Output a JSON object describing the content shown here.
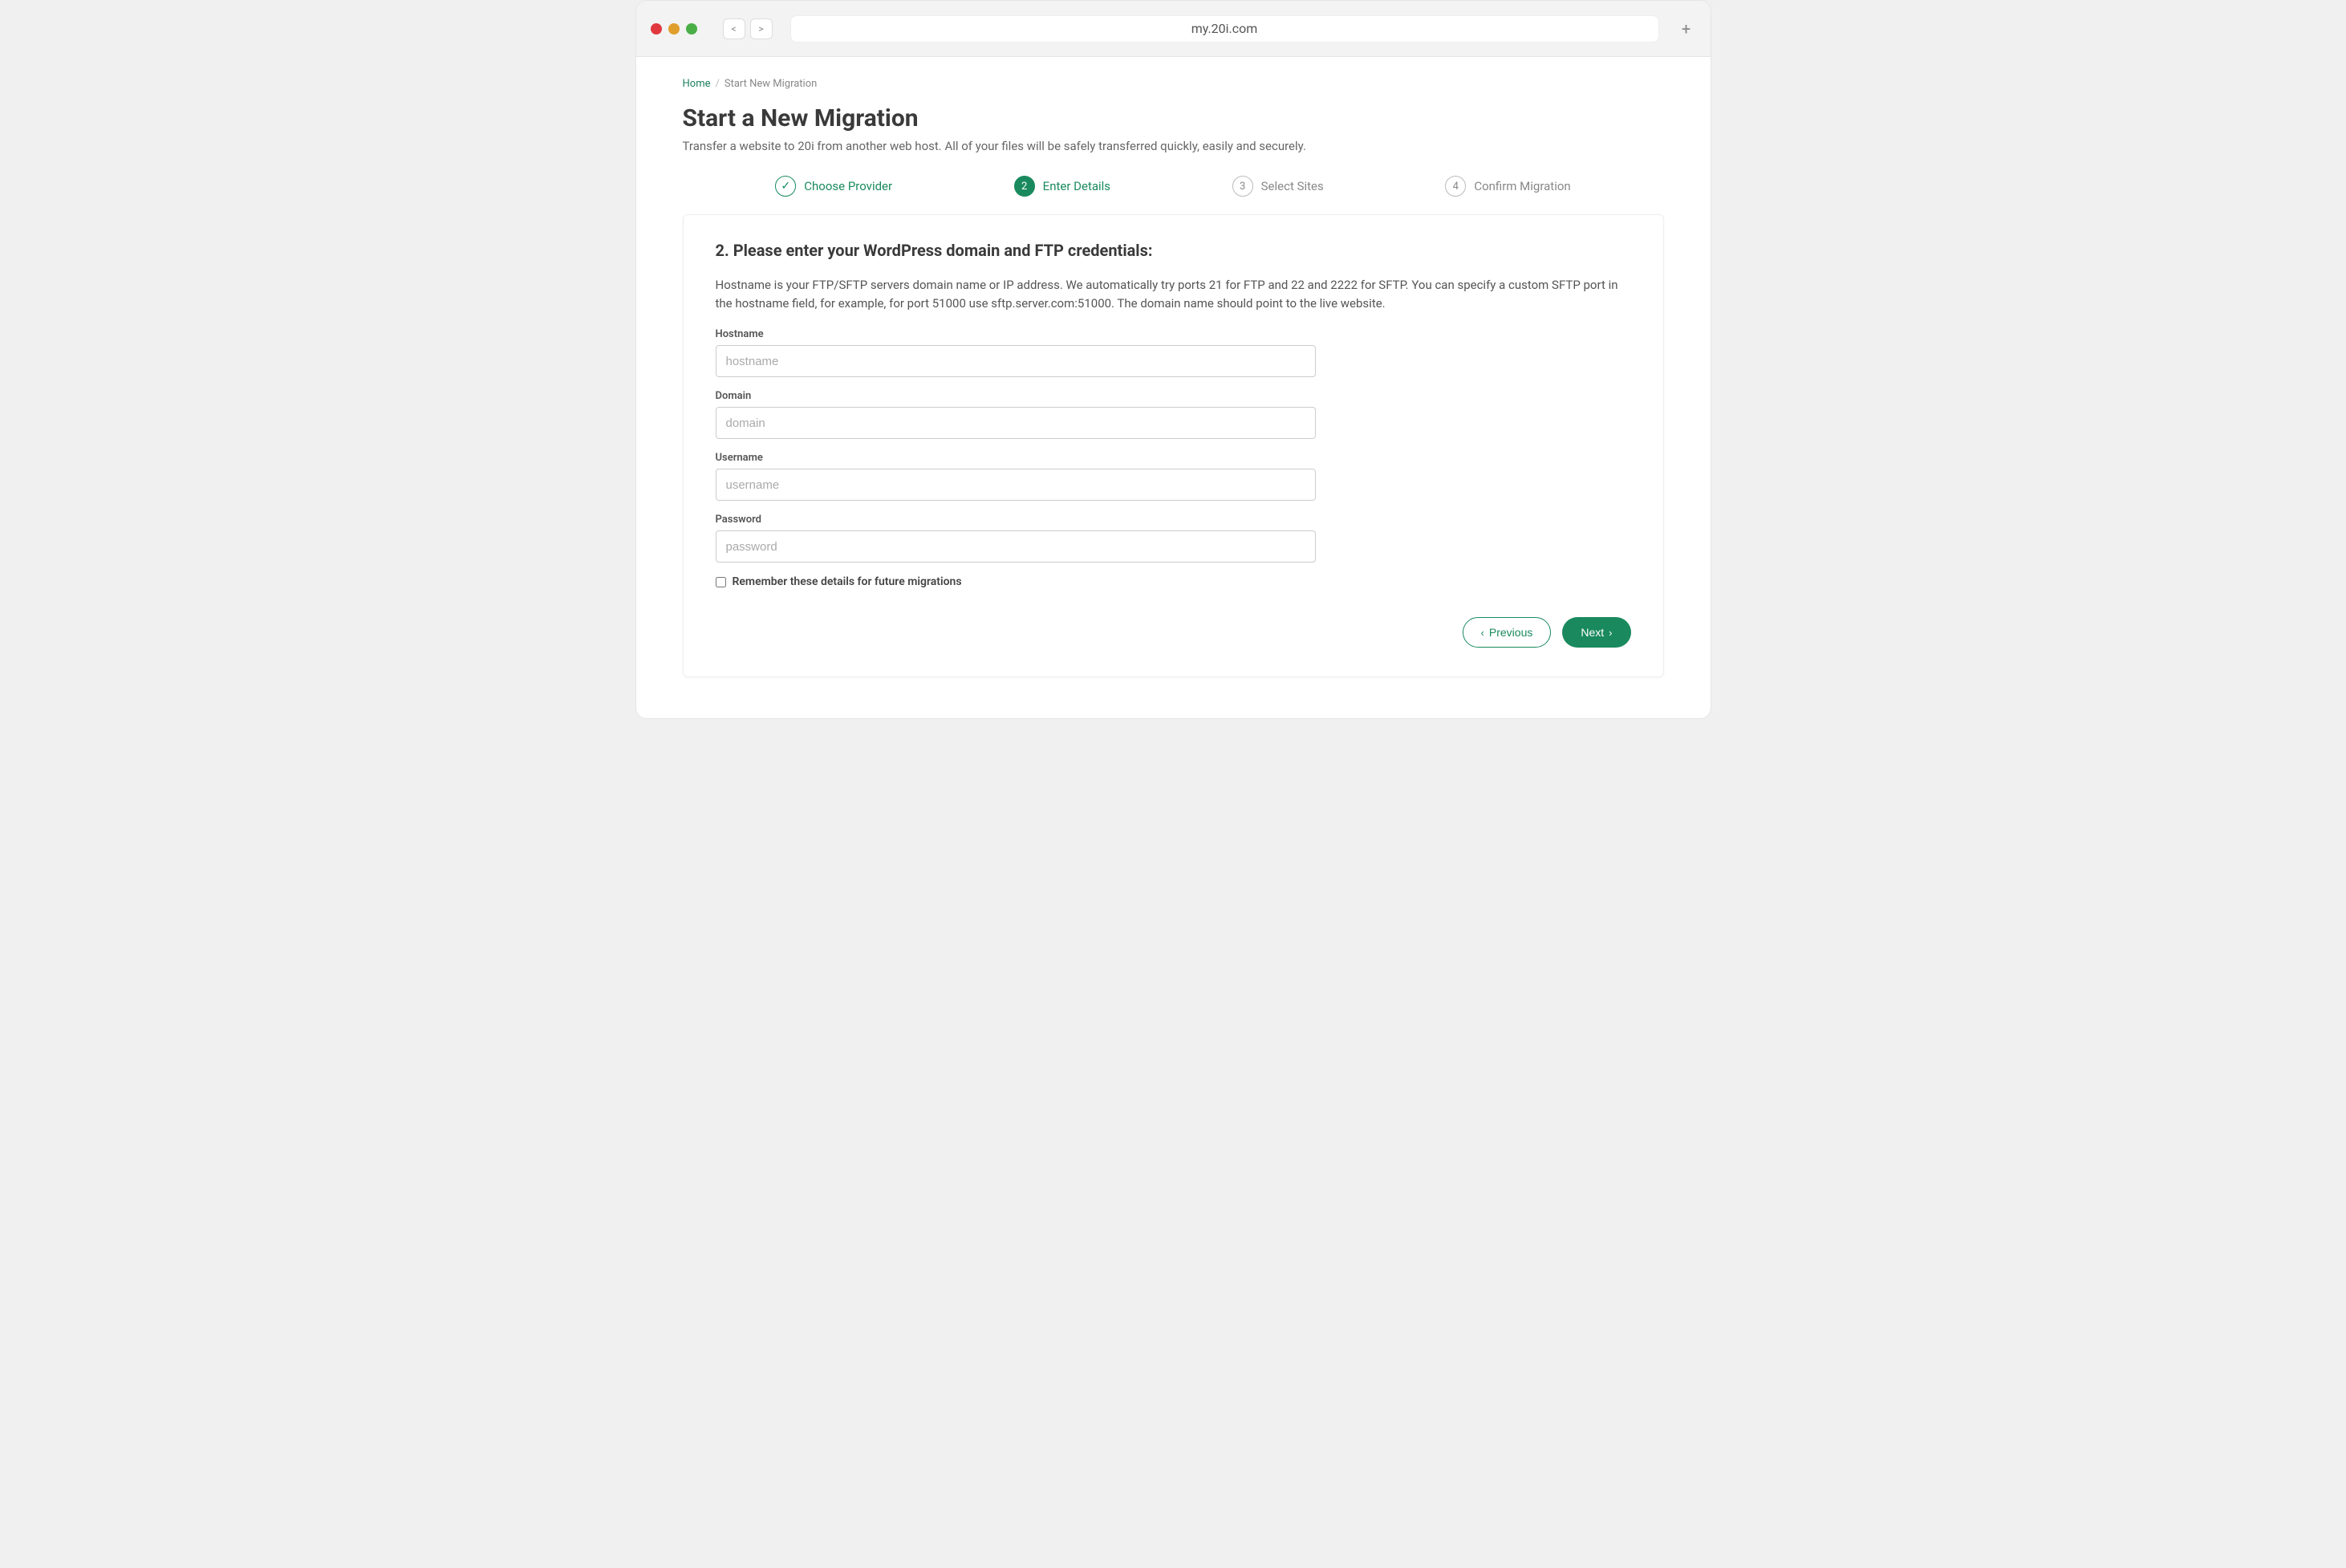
{
  "browser": {
    "url": "my.20i.com",
    "back_label": "<",
    "forward_label": ">",
    "plus_label": "+"
  },
  "breadcrumb": {
    "home": "Home",
    "current": "Start New Migration"
  },
  "page": {
    "title": "Start a New Migration",
    "subtitle": "Transfer a website to 20i from another web host. All of your files will be safely transferred quickly, easily and securely."
  },
  "stepper": {
    "steps": [
      {
        "num": "✓",
        "label": "Choose Provider",
        "state": "done"
      },
      {
        "num": "2",
        "label": "Enter Details",
        "state": "active"
      },
      {
        "num": "3",
        "label": "Select Sites",
        "state": "pending"
      },
      {
        "num": "4",
        "label": "Confirm Migration",
        "state": "pending"
      }
    ]
  },
  "card": {
    "heading": "2. Please enter your WordPress domain and FTP credentials:",
    "desc": "Hostname is your FTP/SFTP servers domain name or IP address. We automatically try ports 21 for FTP and 22 and 2222 for SFTP. You can specify a custom SFTP port in the hostname field, for example, for port 51000 use sftp.server.com:51000. The domain name should point to the live website."
  },
  "form": {
    "hostname": {
      "label": "Hostname",
      "placeholder": "hostname",
      "value": ""
    },
    "domain": {
      "label": "Domain",
      "placeholder": "domain",
      "value": ""
    },
    "username": {
      "label": "Username",
      "placeholder": "username",
      "value": ""
    },
    "password": {
      "label": "Password",
      "placeholder": "password",
      "value": ""
    },
    "remember_label": "Remember these details for future migrations"
  },
  "actions": {
    "previous": "Previous",
    "next": "Next"
  },
  "colors": {
    "accent": "#1a8a5e"
  }
}
